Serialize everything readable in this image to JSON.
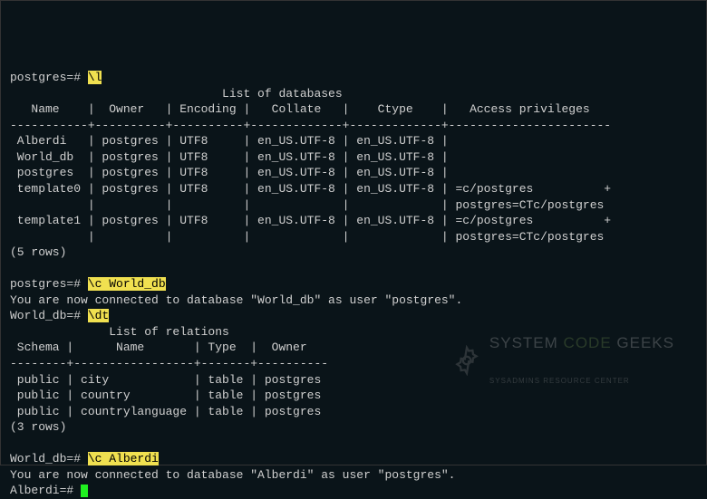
{
  "line1_prompt": "postgres=# ",
  "line1_cmd": "\\l",
  "db_list": {
    "title": "                              List of databases",
    "header": "   Name    |  Owner   | Encoding |   Collate   |    Ctype    |   Access privileges   ",
    "divider": "-----------+----------+----------+-------------+-------------+-----------------------",
    "rows": [
      " Alberdi   | postgres | UTF8     | en_US.UTF-8 | en_US.UTF-8 | ",
      " World_db  | postgres | UTF8     | en_US.UTF-8 | en_US.UTF-8 | ",
      " postgres  | postgres | UTF8     | en_US.UTF-8 | en_US.UTF-8 | ",
      " template0 | postgres | UTF8     | en_US.UTF-8 | en_US.UTF-8 | =c/postgres          +",
      "           |          |          |             |             | postgres=CTc/postgres",
      " template1 | postgres | UTF8     | en_US.UTF-8 | en_US.UTF-8 | =c/postgres          +",
      "           |          |          |             |             | postgres=CTc/postgres"
    ],
    "count": "(5 rows)"
  },
  "line2_prompt": "postgres=# ",
  "line2_cmd": "\\c World_db",
  "connect1": "You are now connected to database \"World_db\" as user \"postgres\".",
  "line3_prompt": "World_db=# ",
  "line3_cmd": "\\dt",
  "rel_list": {
    "title": "              List of relations",
    "header": " Schema |      Name       | Type  |  Owner   ",
    "divider": "--------+-----------------+-------+----------",
    "rows": [
      " public | city            | table | postgres",
      " public | country         | table | postgres",
      " public | countrylanguage | table | postgres"
    ],
    "count": "(3 rows)"
  },
  "line4_prompt": "World_db=# ",
  "line4_cmd": "\\c Alberdi",
  "connect2": "You are now connected to database \"Alberdi\" as user \"postgres\".",
  "line5_prompt": "Alberdi=# ",
  "watermark": {
    "title_a": "SYSTEM",
    "title_b": "CODE",
    "title_c": "GEEKS",
    "subtitle": "SYSADMINS RESOURCE CENTER"
  }
}
